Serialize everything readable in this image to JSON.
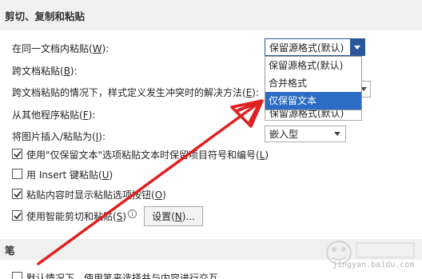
{
  "section1": {
    "title": "剪切、复制和粘贴"
  },
  "rows": {
    "same_doc": {
      "pre": "在同一文档内粘贴(",
      "key": "W",
      "post": "):"
    },
    "cross_doc": {
      "pre": "跨文档粘贴(",
      "key": "B",
      "post": "):"
    },
    "cross_doc_conflict": {
      "pre": "跨文档粘贴的情况下，样式定义发生冲突时的解决方法(",
      "key": "E",
      "post": "):"
    },
    "other_program": {
      "pre": "从其他程序粘贴(",
      "key": "F",
      "post": "):"
    },
    "insert_picture": {
      "pre": "将图片插入/粘贴为(",
      "key": "I",
      "post": "):"
    }
  },
  "combos": {
    "same_doc_value": "保留源格式(默认)",
    "other_program_value": "保留源格式(默认)",
    "insert_picture_value": "嵌入型"
  },
  "dropdown": {
    "options": [
      "保留源格式(默认)",
      "合并格式",
      "仅保留文本"
    ],
    "selected_index": 2
  },
  "checkboxes": [
    {
      "pre": "使用\"仅保留文本\"选项粘贴文本时保留项目符号和编号(",
      "key": "L",
      "post": ")",
      "checked": true
    },
    {
      "pre": "用 Insert 键粘贴(",
      "key": "U",
      "post": ")",
      "checked": false
    },
    {
      "pre": "粘贴内容时显示粘贴选项按钮(",
      "key": "O",
      "post": ")",
      "checked": true
    },
    {
      "pre": "使用智能剪切和粘贴(",
      "key": "S",
      "post": ")",
      "checked": true
    }
  ],
  "settings_button": {
    "pre": "设置(",
    "key": "N",
    "post": ")..."
  },
  "info_icon": "i",
  "section2": {
    "title": "笔"
  },
  "pen_row": {
    "label": "默认情况下，使用笔来选择并与内容进行交互"
  },
  "watermark": {
    "text": "jingyan.baidu.com"
  },
  "colors": {
    "accent": "#2b579a",
    "highlight": "#2b6cc4",
    "annotation_arrow": "#e02020"
  }
}
